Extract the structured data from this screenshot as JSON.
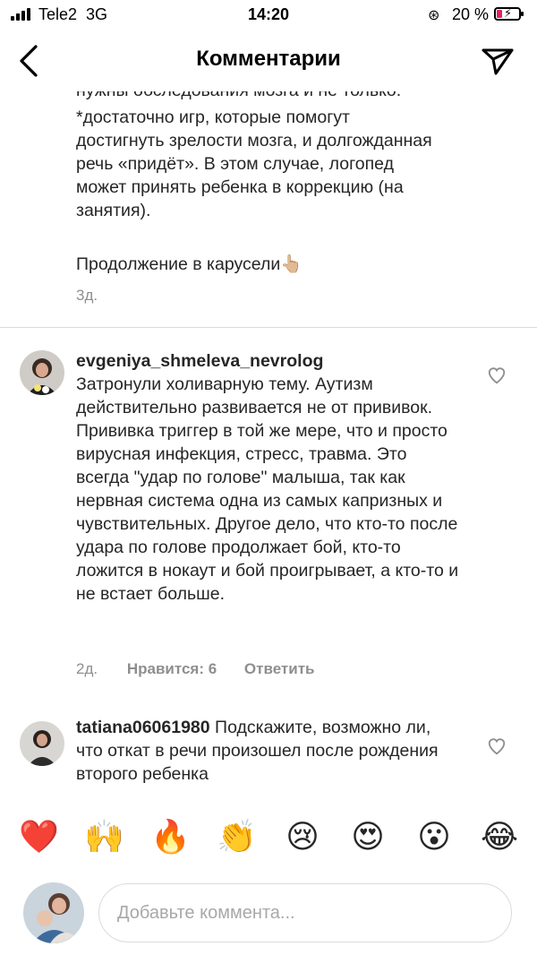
{
  "status_bar": {
    "carrier": "Tele2",
    "network": "3G",
    "time": "14:20",
    "battery": "20 %"
  },
  "header": {
    "title": "Комментарии"
  },
  "caption": {
    "text_top_cut": "нужны обследования мозга и не только.",
    "text": "*достаточно игр, которые помогут\nдостигнуть зрелости мозга, и долгожданная\nречь «придёт». В этом случае, логопед\nможет принять ребенка в коррекцию (на\nзанятия).",
    "continuation": "Продолжение в карусели👆🏼",
    "time": "3д."
  },
  "comments": [
    {
      "username": "evgeniya_shmeleva_nevrolog",
      "text": "Затронули холиварную тему. Аутизм действительно развивается не от прививок. Прививка триггер в той же мере, что и просто вирусная инфекция, стресс, травма. Это всегда \"удар по голове\" малыша, так как нервная система одна из самых капризных и чувствительных. Другое дело, что кто-то после удара по голове продолжает бой, кто-то ложится в нокаут и бой проигрывает, а кто-то и не встает больше.",
      "time": "2д.",
      "likes": "Нравится: 6",
      "reply": "Ответить"
    },
    {
      "username": "tatiana06061980",
      "text": "Подскажите, возможно ли, что откат в речи произошел после рождения второго ребенка"
    }
  ],
  "emojis": [
    "❤️",
    "🙌",
    "🔥",
    "👏",
    "😢",
    "😍",
    "😮",
    "😂"
  ],
  "composer": {
    "placeholder": "Добавьте коммента..."
  },
  "colors": {
    "text": "#262626",
    "secondary": "#8e8e8e",
    "divider": "#dbdbdb",
    "battery_low": "#e0245e"
  },
  "icons": {
    "back": "chevron-left-icon",
    "send": "paper-plane-icon",
    "like": "heart-outline-icon"
  }
}
